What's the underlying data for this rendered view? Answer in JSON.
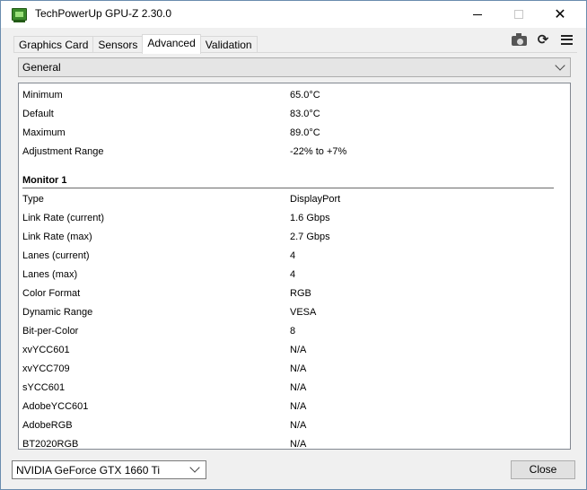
{
  "window": {
    "title": "TechPowerUp GPU-Z 2.30.0",
    "close_glyph": "✕"
  },
  "tabs": [
    {
      "label": "Graphics Card",
      "active": false
    },
    {
      "label": "Sensors",
      "active": false
    },
    {
      "label": "Advanced",
      "active": true
    },
    {
      "label": "Validation",
      "active": false
    }
  ],
  "toolbar": {
    "icons": [
      "camera-icon",
      "refresh-icon",
      "menu-icon"
    ],
    "refresh_glyph": "⟳"
  },
  "category_select": {
    "value": "General"
  },
  "rows_top": [
    {
      "label": "Minimum",
      "value": "65.0°C"
    },
    {
      "label": "Default",
      "value": "83.0°C"
    },
    {
      "label": "Maximum",
      "value": "89.0°C"
    },
    {
      "label": "Adjustment Range",
      "value": "-22% to +7%"
    }
  ],
  "section": {
    "title": "Monitor 1"
  },
  "rows_monitor": [
    {
      "label": "Type",
      "value": "DisplayPort"
    },
    {
      "label": "Link Rate (current)",
      "value": "1.6 Gbps"
    },
    {
      "label": "Link Rate (max)",
      "value": "2.7 Gbps"
    },
    {
      "label": "Lanes (current)",
      "value": "4"
    },
    {
      "label": "Lanes (max)",
      "value": "4"
    },
    {
      "label": "Color Format",
      "value": "RGB"
    },
    {
      "label": "Dynamic Range",
      "value": "VESA"
    },
    {
      "label": "Bit-per-Color",
      "value": "8"
    },
    {
      "label": "xvYCC601",
      "value": "N/A"
    },
    {
      "label": "xvYCC709",
      "value": "N/A"
    },
    {
      "label": "sYCC601",
      "value": "N/A"
    },
    {
      "label": "AdobeYCC601",
      "value": "N/A"
    },
    {
      "label": "AdobeRGB",
      "value": "N/A"
    },
    {
      "label": "BT2020RGB",
      "value": "N/A"
    }
  ],
  "gpu_select": {
    "value": "NVIDIA GeForce GTX 1660 Ti"
  },
  "close_button": {
    "label": "Close"
  },
  "colors": {
    "panel_bg": "#ffffff",
    "window_bg": "#f0f0f0",
    "icon_green": "#3a8a2a"
  }
}
